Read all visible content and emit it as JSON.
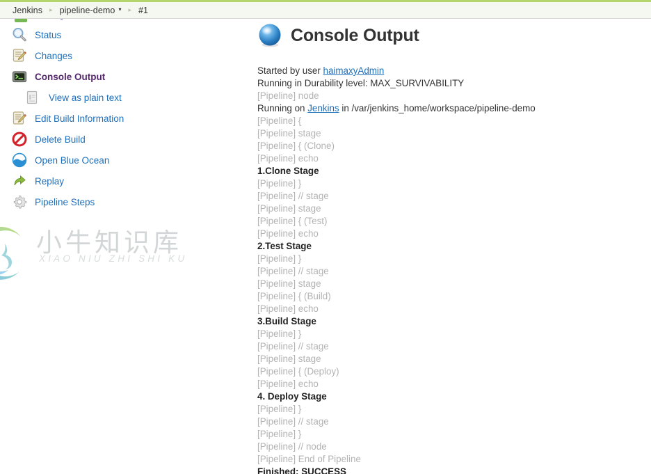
{
  "breadcrumb": {
    "items": [
      {
        "label": "Jenkins",
        "caret": false
      },
      {
        "label": "pipeline-demo",
        "caret": true
      },
      {
        "label": "#1",
        "caret": false
      }
    ],
    "separator": "▸",
    "caret": "▾"
  },
  "sidebar": {
    "items": [
      {
        "label": "Status",
        "icon": "magnifier-icon",
        "active": false,
        "sub": false
      },
      {
        "label": "Changes",
        "icon": "notepad-pencil-icon",
        "active": false,
        "sub": false
      },
      {
        "label": "Console Output",
        "icon": "terminal-icon",
        "active": true,
        "sub": false
      },
      {
        "label": "View as plain text",
        "icon": "document-icon",
        "active": false,
        "sub": true
      },
      {
        "label": "Edit Build Information",
        "icon": "notepad-pencil-icon",
        "active": false,
        "sub": false
      },
      {
        "label": "Delete Build",
        "icon": "delete-prohibited-icon",
        "active": false,
        "sub": false
      },
      {
        "label": "Open Blue Ocean",
        "icon": "blue-ocean-icon",
        "active": false,
        "sub": false
      },
      {
        "label": "Replay",
        "icon": "replay-arrow-icon",
        "active": false,
        "sub": false
      },
      {
        "label": "Pipeline Steps",
        "icon": "gear-icon",
        "active": false,
        "sub": false
      }
    ]
  },
  "main": {
    "title": "Console Output",
    "status_icon": "blue-ball-success-icon",
    "log": [
      {
        "style": "normal",
        "parts": [
          {
            "t": "Started by user ",
            "link": false
          },
          {
            "t": "haimaxyAdmin",
            "link": true
          }
        ]
      },
      {
        "style": "normal",
        "parts": [
          {
            "t": "Running in Durability level: MAX_SURVIVABILITY",
            "link": false
          }
        ]
      },
      {
        "style": "pipe",
        "parts": [
          {
            "t": "[Pipeline] node",
            "link": false
          }
        ]
      },
      {
        "style": "normal",
        "parts": [
          {
            "t": "Running on ",
            "link": false
          },
          {
            "t": "Jenkins",
            "link": true
          },
          {
            "t": " in /var/jenkins_home/workspace/pipeline-demo",
            "link": false
          }
        ]
      },
      {
        "style": "pipe",
        "parts": [
          {
            "t": "[Pipeline] {",
            "link": false
          }
        ]
      },
      {
        "style": "pipe",
        "parts": [
          {
            "t": "[Pipeline] stage",
            "link": false
          }
        ]
      },
      {
        "style": "pipe",
        "parts": [
          {
            "t": "[Pipeline] { (Clone)",
            "link": false
          }
        ]
      },
      {
        "style": "pipe",
        "parts": [
          {
            "t": "[Pipeline] echo",
            "link": false
          }
        ]
      },
      {
        "style": "emph",
        "parts": [
          {
            "t": "1.Clone Stage",
            "link": false
          }
        ]
      },
      {
        "style": "pipe",
        "parts": [
          {
            "t": "[Pipeline] }",
            "link": false
          }
        ]
      },
      {
        "style": "pipe",
        "parts": [
          {
            "t": "[Pipeline] // stage",
            "link": false
          }
        ]
      },
      {
        "style": "pipe",
        "parts": [
          {
            "t": "[Pipeline] stage",
            "link": false
          }
        ]
      },
      {
        "style": "pipe",
        "parts": [
          {
            "t": "[Pipeline] { (Test)",
            "link": false
          }
        ]
      },
      {
        "style": "pipe",
        "parts": [
          {
            "t": "[Pipeline] echo",
            "link": false
          }
        ]
      },
      {
        "style": "emph",
        "parts": [
          {
            "t": "2.Test Stage",
            "link": false
          }
        ]
      },
      {
        "style": "pipe",
        "parts": [
          {
            "t": "[Pipeline] }",
            "link": false
          }
        ]
      },
      {
        "style": "pipe",
        "parts": [
          {
            "t": "[Pipeline] // stage",
            "link": false
          }
        ]
      },
      {
        "style": "pipe",
        "parts": [
          {
            "t": "[Pipeline] stage",
            "link": false
          }
        ]
      },
      {
        "style": "pipe",
        "parts": [
          {
            "t": "[Pipeline] { (Build)",
            "link": false
          }
        ]
      },
      {
        "style": "pipe",
        "parts": [
          {
            "t": "[Pipeline] echo",
            "link": false
          }
        ]
      },
      {
        "style": "emph",
        "parts": [
          {
            "t": "3.Build Stage",
            "link": false
          }
        ]
      },
      {
        "style": "pipe",
        "parts": [
          {
            "t": "[Pipeline] }",
            "link": false
          }
        ]
      },
      {
        "style": "pipe",
        "parts": [
          {
            "t": "[Pipeline] // stage",
            "link": false
          }
        ]
      },
      {
        "style": "pipe",
        "parts": [
          {
            "t": "[Pipeline] stage",
            "link": false
          }
        ]
      },
      {
        "style": "pipe",
        "parts": [
          {
            "t": "[Pipeline] { (Deploy)",
            "link": false
          }
        ]
      },
      {
        "style": "pipe",
        "parts": [
          {
            "t": "[Pipeline] echo",
            "link": false
          }
        ]
      },
      {
        "style": "emph",
        "parts": [
          {
            "t": "4. Deploy Stage",
            "link": false
          }
        ]
      },
      {
        "style": "pipe",
        "parts": [
          {
            "t": "[Pipeline] }",
            "link": false
          }
        ]
      },
      {
        "style": "pipe",
        "parts": [
          {
            "t": "[Pipeline] // stage",
            "link": false
          }
        ]
      },
      {
        "style": "pipe",
        "parts": [
          {
            "t": "[Pipeline] }",
            "link": false
          }
        ]
      },
      {
        "style": "pipe",
        "parts": [
          {
            "t": "[Pipeline] // node",
            "link": false
          }
        ]
      },
      {
        "style": "pipe",
        "parts": [
          {
            "t": "[Pipeline] End of Pipeline",
            "link": false
          }
        ]
      },
      {
        "style": "emph",
        "parts": [
          {
            "t": "Finished: SUCCESS",
            "link": false
          }
        ]
      }
    ]
  },
  "watermark": {
    "chinese": "小牛知识库",
    "pinyin": "XIAO NIU ZHI SHI KU",
    "logo_icon": "ox-circle-logo-icon"
  },
  "colors": {
    "breadcrumb_bg": "#f5f8f0",
    "breadcrumb_border": "#b4d66c",
    "link": "#1e6fba",
    "visited_link": "#54266b",
    "pipeline_gray": "#b3b3b3",
    "text": "#333333"
  }
}
